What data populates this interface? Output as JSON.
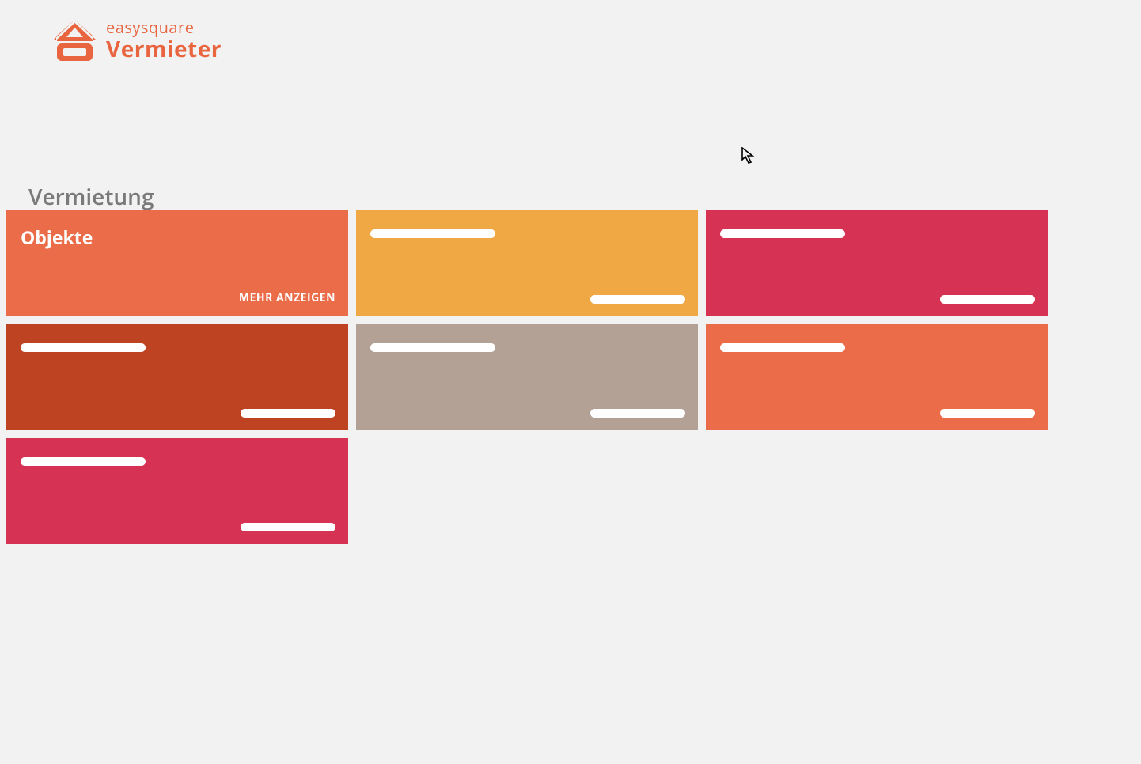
{
  "brand": {
    "top": "easysquare",
    "bottom": "Vermieter"
  },
  "section_title": "Vermietung",
  "tiles": [
    {
      "title": "Objekte",
      "footer": "MEHR ANZEIGEN",
      "bg": "#EA6C48",
      "title_redacted": false,
      "footer_redacted": false
    },
    {
      "title": "",
      "footer": "",
      "bg": "#EFA843",
      "title_redacted": true,
      "footer_redacted": true
    },
    {
      "title": "",
      "footer": "",
      "bg": "#D63253",
      "title_redacted": true,
      "footer_redacted": true
    },
    {
      "title": "",
      "footer": "",
      "bg": "#BE4322",
      "title_redacted": true,
      "footer_redacted": true
    },
    {
      "title": "",
      "footer": "",
      "bg": "#B3A195",
      "title_redacted": true,
      "footer_redacted": true
    },
    {
      "title": "",
      "footer": "",
      "bg": "#EA6C48",
      "title_redacted": true,
      "footer_redacted": true
    },
    {
      "title": "",
      "footer": "",
      "bg": "#D63253",
      "title_redacted": true,
      "footer_redacted": true
    }
  ]
}
